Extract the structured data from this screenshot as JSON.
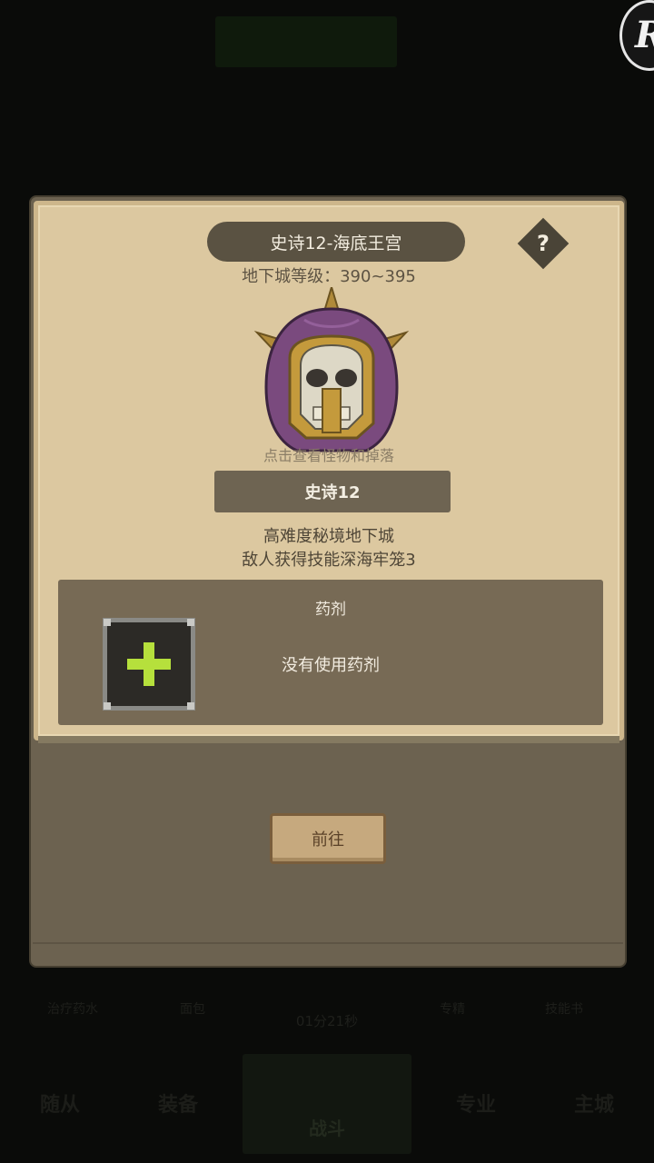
{
  "background": {
    "top_banner": "",
    "bottom_labels": [
      "治疗药水",
      "面包",
      "专精",
      "技能书"
    ],
    "timer": "01分21秒",
    "tabs": [
      "随从",
      "装备",
      "战斗",
      "专业",
      "主城"
    ]
  },
  "dialog": {
    "title": "史诗12-海底王宫",
    "help_label": "?",
    "level_label": "地下城等级：390~395",
    "monster_icon": "armored-skull-icon",
    "view_hint": "点击查看怪物和掉落",
    "mode_label": "史诗12",
    "description_lines": [
      "高难度秘境地下城",
      "敌人获得技能深海牢笼3"
    ],
    "potion": {
      "title": "药剂",
      "slot_icon": "plus-icon",
      "status": "没有使用药剂"
    },
    "go_button": "前往"
  },
  "colors": {
    "paper": "#dcc8a0",
    "panel": "#776a55",
    "accent_plus": "#b6e03c",
    "button": "#c6a97e"
  }
}
